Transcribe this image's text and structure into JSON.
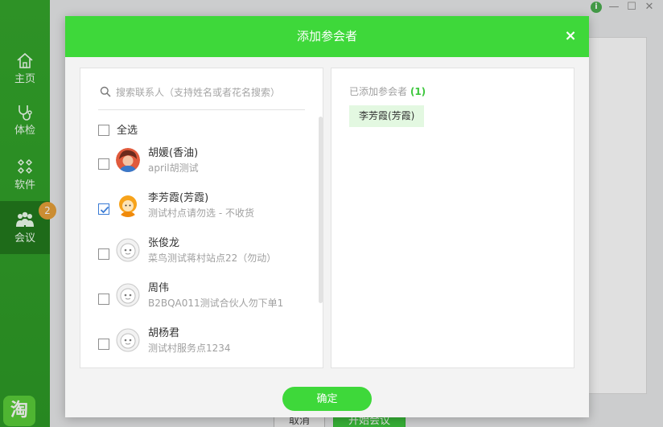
{
  "sidebar": {
    "items": [
      {
        "label": "主页",
        "icon": "home-icon"
      },
      {
        "label": "体检",
        "icon": "stethoscope-icon"
      },
      {
        "label": "软件",
        "icon": "apps-icon"
      },
      {
        "label": "会议",
        "icon": "meeting-icon",
        "badge": "2",
        "active": true
      }
    ],
    "brand_icon": "淘"
  },
  "background": {
    "cancel_label": "取消",
    "start_label": "开始会议"
  },
  "dialog": {
    "title": "添加参会者",
    "close_icon": "×",
    "search": {
      "placeholder": "搜索联系人（支持姓名或者花名搜索）",
      "value": ""
    },
    "select_all_label": "全选",
    "contacts": [
      {
        "name": "胡媛(香油)",
        "sub": "april胡测试",
        "checked": false,
        "avatar": "photo-red"
      },
      {
        "name": "李芳霞(芳霞)",
        "sub": "测试村点请勿选 - 不收货",
        "checked": true,
        "avatar": "cartoon-orange"
      },
      {
        "name": "张俊龙",
        "sub": "菜鸟测试蒋村站点22（勿动）",
        "checked": false,
        "avatar": "default-face"
      },
      {
        "name": "周伟",
        "sub": "B2BQA011测试合伙人勿下单1",
        "checked": false,
        "avatar": "default-face"
      },
      {
        "name": "胡杨君",
        "sub": "测试村服务点1234",
        "checked": false,
        "avatar": "default-face"
      }
    ],
    "added": {
      "title": "已添加参会者",
      "count": "(1)",
      "items": [
        "李芳霞(芳霞)"
      ]
    },
    "confirm_label": "确定"
  },
  "colors": {
    "accent": "#3ed83a",
    "sidebar": "#2d9a26",
    "check": "#3a7bd5",
    "chip": "#e3f8e1"
  }
}
